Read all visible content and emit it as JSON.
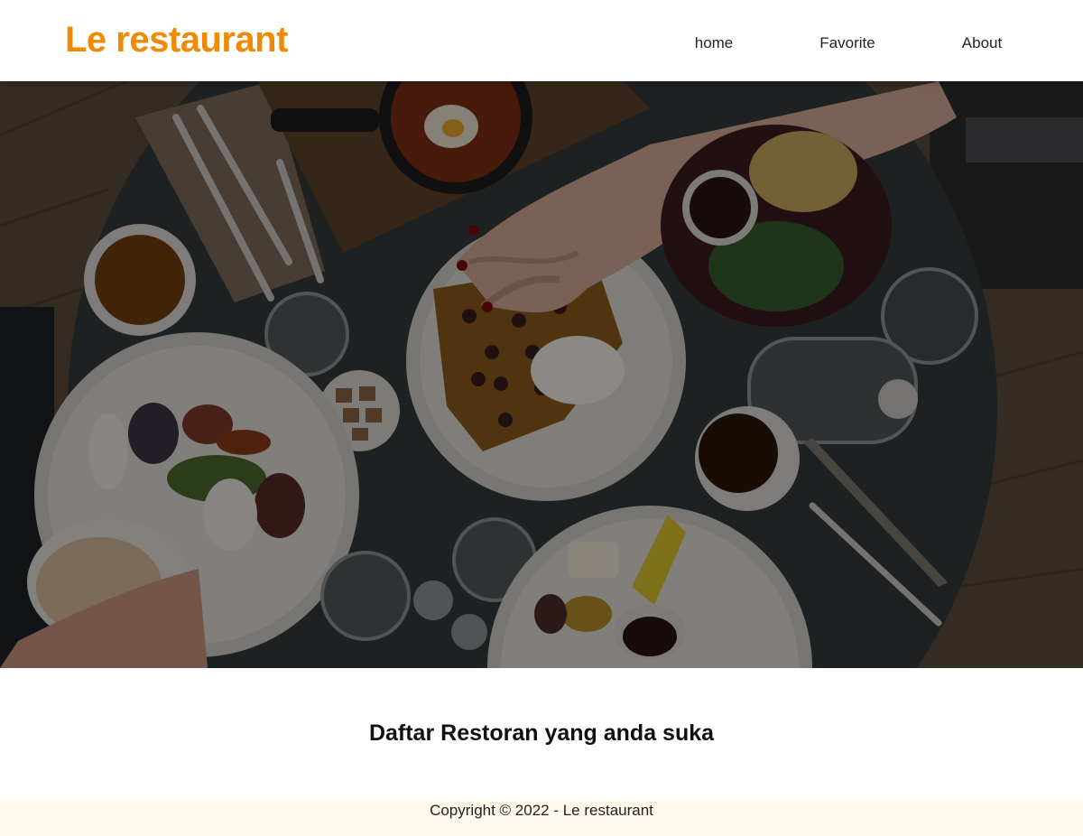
{
  "header": {
    "brand": "Le restaurant",
    "nav": [
      {
        "label": "home"
      },
      {
        "label": "Favorite"
      },
      {
        "label": "About"
      }
    ]
  },
  "colors": {
    "brand": "#f08a05",
    "footer_bg": "#fff8ee"
  },
  "main": {
    "title": "Daftar Restoran yang anda suka"
  },
  "footer": {
    "copyright": "Copyright © 2022 - Le restaurant"
  }
}
